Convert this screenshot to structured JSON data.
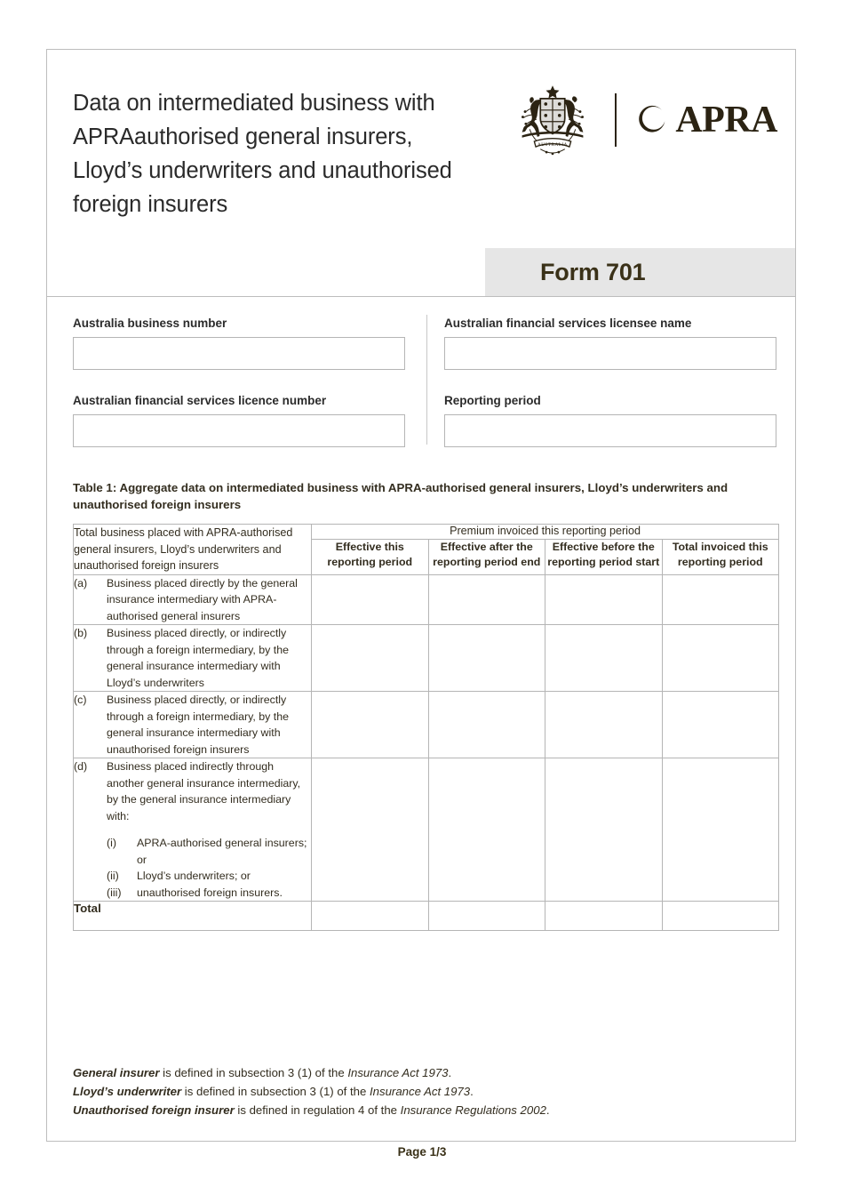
{
  "document": {
    "title": "Data on intermediated business with APRAauthorised general insurers, Lloyd’s underwriters and unauthorised foreign insurers",
    "form_banner_label": "Form 701",
    "page_footer": "Page 1/3"
  },
  "branding": {
    "coat_of_arms_alt": "Commonwealth Coat of Arms of Australia",
    "agency_name": "APRA"
  },
  "identity_fields": [
    {
      "label": "Australia business number",
      "value": "",
      "placeholder": ""
    },
    {
      "label": "Australian financial services licensee name",
      "value": "",
      "placeholder": ""
    },
    {
      "label": "Australian financial services licence number",
      "value": "",
      "placeholder": ""
    },
    {
      "label": "Reporting period",
      "value": "",
      "placeholder": ""
    }
  ],
  "table": {
    "caption": "Table 1: Aggregate data on intermediated business with APRA-authorised general insurers, Lloyd’s underwriters and unauthorised foreign insurers",
    "row_header_label": "Total business placed with APRA-authorised general insurers, Lloyd’s underwriters and unauthorised foreign insurers",
    "group_header": "Premium invoiced this reporting period",
    "column_headers": [
      "Effective this reporting period",
      "Effective after the reporting period end",
      "Effective before the reporting period start",
      "Total invoiced this reporting period"
    ],
    "rows": [
      {
        "marker": "(a)",
        "text": "Business placed directly by the general insurance intermediary with APRA-authorised general insurers",
        "values": [
          "",
          "",
          "",
          ""
        ]
      },
      {
        "marker": "(b)",
        "text": "Business placed directly, or indirectly through a foreign intermediary, by the general insurance intermediary with Lloyd’s underwriters",
        "values": [
          "",
          "",
          "",
          ""
        ]
      },
      {
        "marker": "(c)",
        "text": "Business placed directly, or indirectly through a foreign intermediary, by the general insurance intermediary with unauthorised foreign insurers",
        "values": [
          "",
          "",
          "",
          ""
        ]
      },
      {
        "marker": "(d)",
        "text": "Business placed indirectly through another general insurance intermediary, by the general insurance intermediary with:",
        "subitems": [
          {
            "marker": "(i)",
            "text": "APRA-authorised general insurers; or"
          },
          {
            "marker": "(ii)",
            "text": "Lloyd’s underwriters; or"
          },
          {
            "marker": "(iii)",
            "text": "unauthorised foreign insurers."
          }
        ],
        "values": [
          "",
          "",
          "",
          ""
        ]
      }
    ],
    "total_row": {
      "label": "Total",
      "values": [
        "",
        "",
        "",
        ""
      ]
    }
  },
  "footnotes": [
    {
      "term": "General insurer",
      "middle": " is defined in subsection 3 (1) of the ",
      "act": "Insurance Act 1973",
      "tail": "."
    },
    {
      "term": "Lloyd’s underwriter",
      "middle": " is defined in subsection 3 (1) of the ",
      "act": "Insurance Act 1973",
      "tail": "."
    },
    {
      "term": "Unauthorised foreign insurer",
      "middle": " is defined in regulation 4 of the ",
      "act": "Insurance Regulations 2002",
      "tail": "."
    }
  ],
  "colors": {
    "text": "#332d1f",
    "title": "#2a2a2a",
    "banner_background": "#e6e6e6",
    "border": "#b5b5b5",
    "page_border": "#bdbdbd"
  }
}
